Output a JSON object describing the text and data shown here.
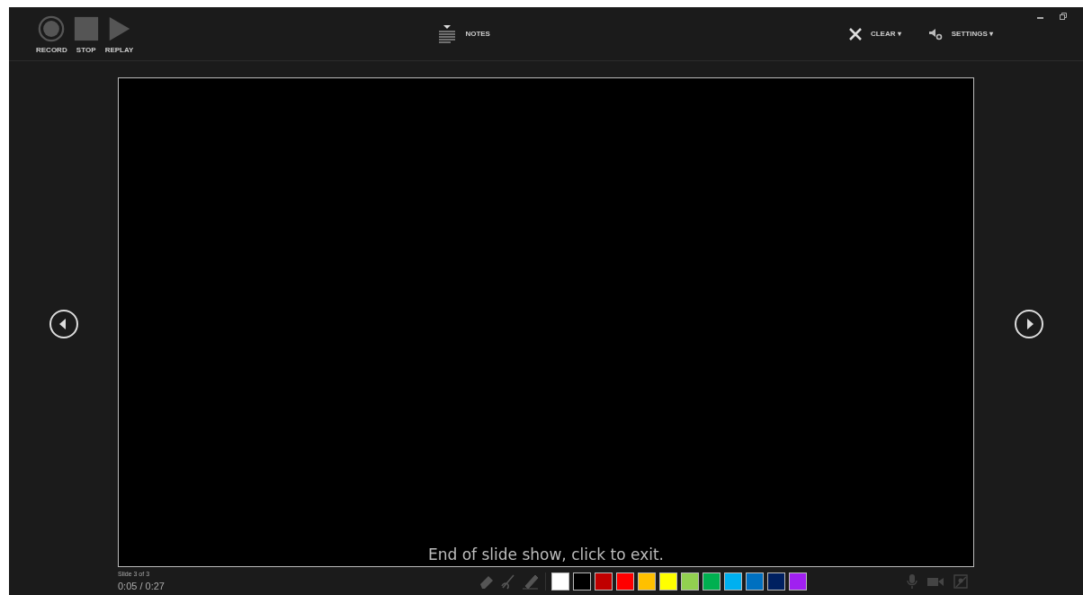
{
  "toolbar": {
    "record": "RECORD",
    "stop": "STOP",
    "replay": "REPLAY",
    "notes": "NOTES",
    "clear": "CLEAR ▾",
    "settings": "SETTINGS ▾"
  },
  "slide": {
    "message": "End of slide show, click to exit."
  },
  "status": {
    "slide": "Slide 3 of 3",
    "time": "0:05 / 0:27"
  },
  "pen_colors": [
    {
      "color": "#ffffff"
    },
    {
      "color": "#000000"
    },
    {
      "color": "#c00000"
    },
    {
      "color": "#ff0000"
    },
    {
      "color": "#ffc000"
    },
    {
      "color": "#ffff00"
    },
    {
      "color": "#92d050"
    },
    {
      "color": "#00b050"
    },
    {
      "color": "#00b0f0"
    },
    {
      "color": "#0070c0"
    },
    {
      "color": "#002060"
    },
    {
      "color": "#a020f0"
    }
  ]
}
